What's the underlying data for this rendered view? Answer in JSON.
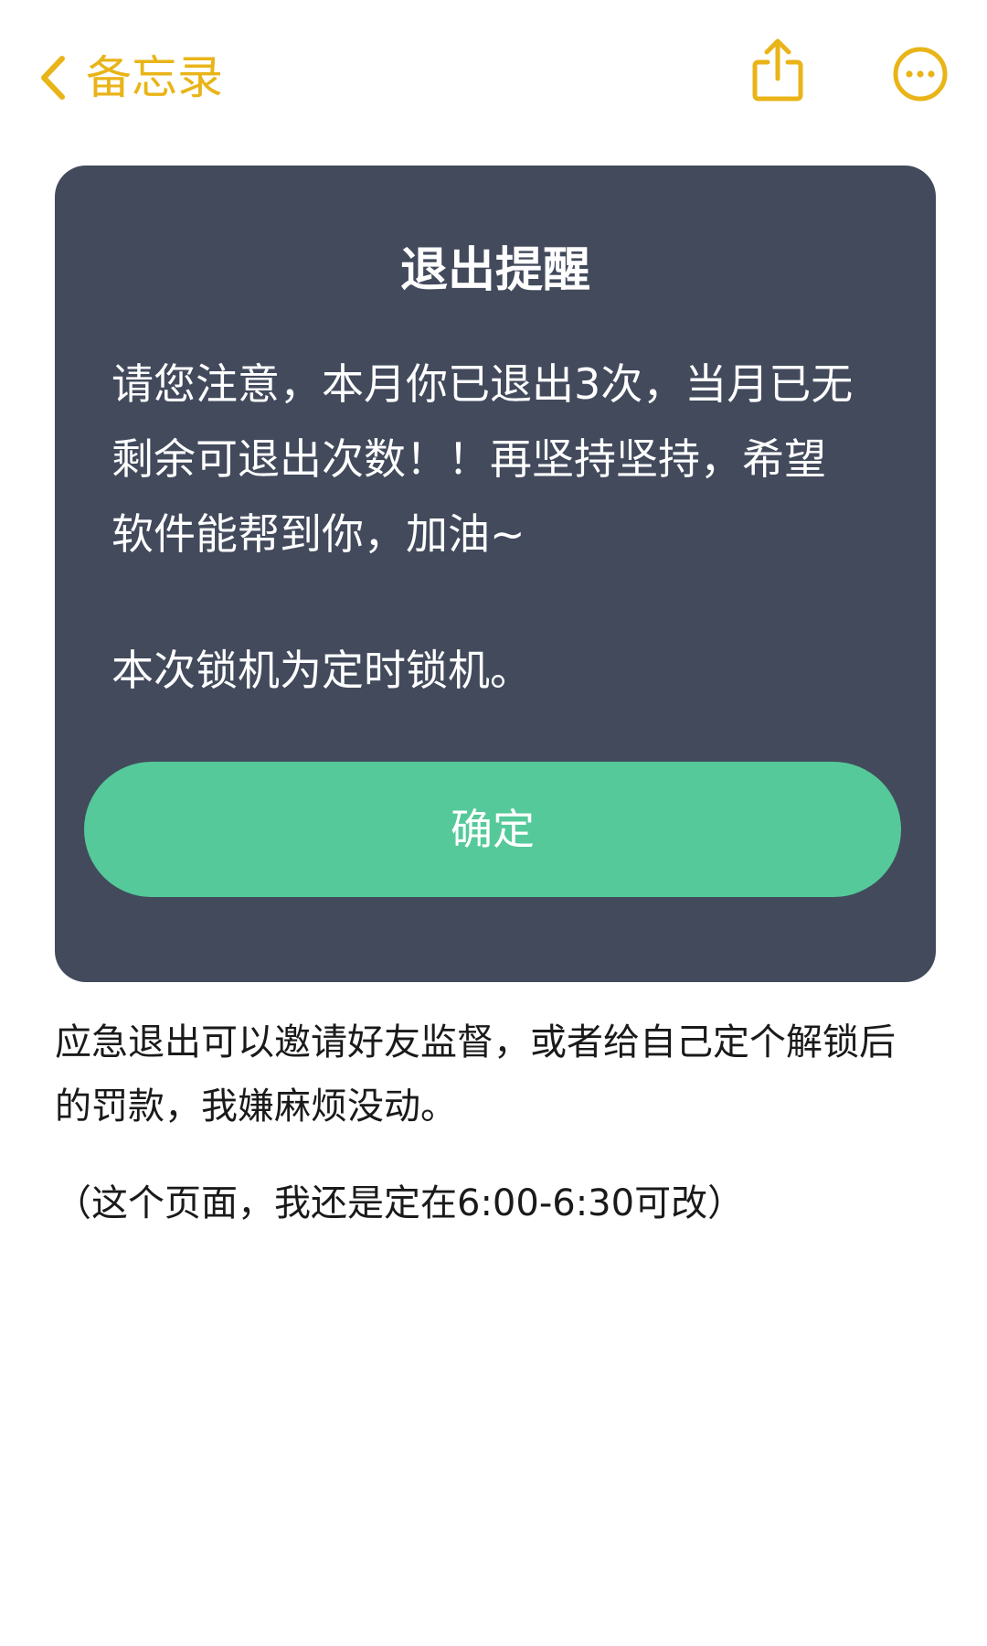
{
  "nav": {
    "back_label": "备忘录",
    "back_icon": "chevron-left-icon",
    "share_icon": "share-icon",
    "more_icon": "more-icon",
    "accent_color": "#E9B418"
  },
  "dialog": {
    "title": "退出提醒",
    "body_lines": [
      "请您注意，本月你已退出3次，当月已无",
      "剩余可退出次数！！再坚持坚持，希望",
      "软件能帮到你，加油~"
    ],
    "body_extra": "本次锁机为定时锁机。",
    "confirm_label": "确定",
    "background_color": "#424A5C",
    "button_color": "#55C99A"
  },
  "note": {
    "paragraph_1_lines": [
      "应急退出可以邀请好友监督，或者给自己定个解锁后",
      "的罚款，我嫌麻烦没动。"
    ],
    "paragraph_2": "（这个页面，我还是定在6:00-6:30可改）"
  }
}
